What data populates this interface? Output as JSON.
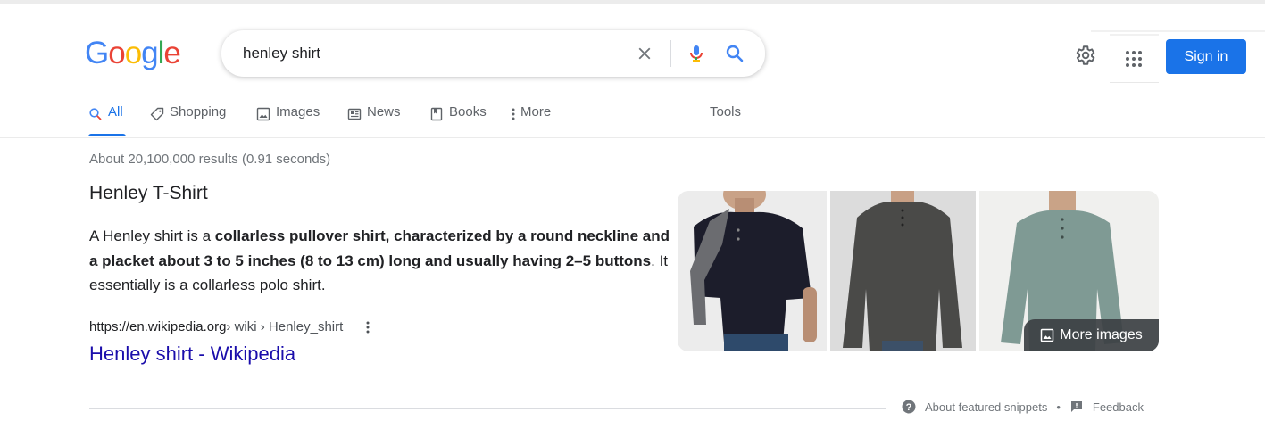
{
  "logo": {
    "text": "Google",
    "letters": [
      "G",
      "o",
      "o",
      "g",
      "l",
      "e"
    ],
    "colors": [
      "#4285F4",
      "#EA4335",
      "#FBBC05",
      "#4285F4",
      "#34A853",
      "#EA4335"
    ]
  },
  "search": {
    "value": "henley shirt",
    "placeholder": ""
  },
  "header": {
    "signin_label": "Sign in"
  },
  "tabs": [
    {
      "label": "All",
      "icon": "search-icon",
      "active": true
    },
    {
      "label": "Shopping",
      "icon": "tag-icon",
      "active": false
    },
    {
      "label": "Images",
      "icon": "image-icon",
      "active": false
    },
    {
      "label": "News",
      "icon": "news-icon",
      "active": false
    },
    {
      "label": "Books",
      "icon": "book-icon",
      "active": false
    },
    {
      "label": "More",
      "icon": "more-vertical-icon",
      "active": false
    }
  ],
  "tools_label": "Tools",
  "stats": "About 20,100,000 results (0.91 seconds)",
  "snippet": {
    "title": "Henley T-Shirt",
    "text_1": "A Henley shirt is a ",
    "bold": "collarless pullover shirt, characterized by a round neckline and a placket about 3 to 5 inches (8 to 13 cm) long and usually having 2–5 buttons",
    "text_2": ". It essentially is a collarless polo shirt.",
    "cite_domain": "https://en.wikipedia.org",
    "cite_path": " › wiki › Henley_shirt",
    "link_title": "Henley shirt - Wikipedia"
  },
  "images": {
    "more_label": "More images",
    "items": [
      {
        "icon": "man-navy-henley-image",
        "shirt": "#1c1d2b"
      },
      {
        "icon": "man-gray-henley-image",
        "shirt": "#4a4a48"
      },
      {
        "icon": "man-sage-henley-image",
        "shirt": "#7f9a94"
      }
    ]
  },
  "footer": {
    "about": "About featured snippets",
    "separator": "•",
    "feedback": "Feedback"
  },
  "colors": {
    "accent": "#1a73e8",
    "link": "#1a0dab",
    "muted": "#70757a"
  }
}
